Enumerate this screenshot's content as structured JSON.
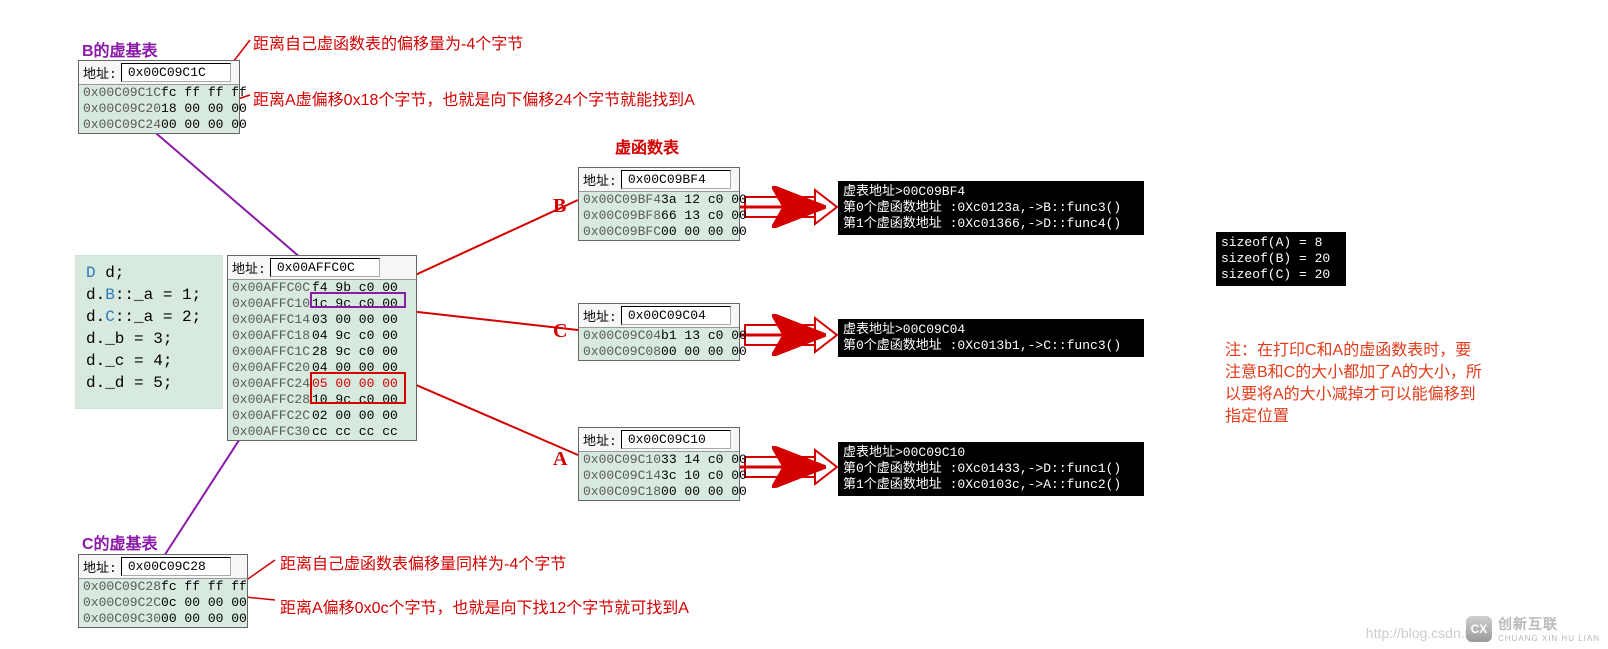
{
  "titles": {
    "b_vbase": "B的虚基表",
    "c_vbase": "C的虚基表",
    "vftable": "虚函数表",
    "letter_B": "B",
    "letter_C": "C",
    "letter_A": "A"
  },
  "annotations": {
    "b_off_self": "距离自己虚函数表的偏移量为-4个字节",
    "b_off_a": "距离A虚偏移0x18个字节，也就是向下偏移24个字节就能找到A",
    "c_off_self": "距离自己虚函数表偏移量同样为-4个字节",
    "c_off_a": "距离A偏移0x0c个字节，也就是向下找12个字节就可找到A"
  },
  "addr_label": "地址:",
  "tables": {
    "b_vbase": {
      "addr": "0x00C09C1C",
      "rows": [
        {
          "a": "0x00C09C1C",
          "b": "fc ff ff ff"
        },
        {
          "a": "0x00C09C20",
          "b": "18 00 00 00"
        },
        {
          "a": "0x00C09C24",
          "b": "00 00 00 00"
        }
      ]
    },
    "d_mem": {
      "addr": "0x00AFFC0C",
      "rows": [
        {
          "a": "0x00AFFC0C",
          "b": "f4 9b c0 00"
        },
        {
          "a": "0x00AFFC10",
          "b": "1c 9c c0 00"
        },
        {
          "a": "0x00AFFC14",
          "b": "03 00 00 00"
        },
        {
          "a": "0x00AFFC18",
          "b": "04 9c c0 00"
        },
        {
          "a": "0x00AFFC1C",
          "b": "28 9c c0 00"
        },
        {
          "a": "0x00AFFC20",
          "b": "04 00 00 00"
        },
        {
          "a": "0x00AFFC24",
          "b": "05 00 00 00",
          "redtext": true
        },
        {
          "a": "0x00AFFC28",
          "b": "10 9c c0 00"
        },
        {
          "a": "0x00AFFC2C",
          "b": "02 00 00 00"
        },
        {
          "a": "0x00AFFC30",
          "b": "cc cc cc cc"
        }
      ]
    },
    "vft_b": {
      "addr": "0x00C09BF4",
      "rows": [
        {
          "a": "0x00C09BF4",
          "b": "3a 12 c0 00"
        },
        {
          "a": "0x00C09BF8",
          "b": "66 13 c0 00"
        },
        {
          "a": "0x00C09BFC",
          "b": "00 00 00 00"
        }
      ]
    },
    "vft_c": {
      "addr": "0x00C09C04",
      "rows": [
        {
          "a": "0x00C09C04",
          "b": "b1 13 c0 00"
        },
        {
          "a": "0x00C09C08",
          "b": "00 00 00 00"
        }
      ]
    },
    "vft_a": {
      "addr": "0x00C09C10",
      "rows": [
        {
          "a": "0x00C09C10",
          "b": "33 14 c0 00"
        },
        {
          "a": "0x00C09C14",
          "b": "3c 10 c0 00"
        },
        {
          "a": "0x00C09C18",
          "b": "00 00 00 00"
        }
      ]
    },
    "c_vbase": {
      "addr": "0x00C09C28",
      "rows": [
        {
          "a": "0x00C09C28",
          "b": "fc ff ff ff"
        },
        {
          "a": "0x00C09C2C",
          "b": "0c 00 00 00"
        },
        {
          "a": "0x00C09C30",
          "b": "00 00 00 00"
        }
      ]
    }
  },
  "code": {
    "l1_a": "D ",
    "l1_b": "d;",
    "l2_a": "d.",
    "l2_b": "B",
    "l2_c": "::_a = 1;",
    "l3_a": "d.",
    "l3_b": "C",
    "l3_c": "::_a = 2;",
    "l4": "d._b = 3;",
    "l5": "d._c = 4;",
    "l6": "d._d = 5;"
  },
  "consoles": {
    "b": "虚表地址>00C09BF4\n第0个虚函数地址 :0Xc0123a,->B::func3()\n第1个虚函数地址 :0Xc01366,->D::func4()",
    "c": "虚表地址>00C09C04\n第0个虚函数地址 :0Xc013b1,->C::func3()",
    "a": "虚表地址>00C09C10\n第0个虚函数地址 :0Xc01433,->D::func1()\n第1个虚函数地址 :0Xc0103c,->A::func2()",
    "sizeof": "sizeof(A) = 8\nsizeof(B) = 20\nsizeof(C) = 20"
  },
  "note": "注：在打印C和A的虚函数表时，要注意B和C的大小都加了A的大小，所以要将A的大小减掉才可以能偏移到指定位置",
  "watermark": "http://blog.csdn.net/",
  "logo_text": "创新互联",
  "logo_sub": "CHUANG XIN HU LIAN"
}
